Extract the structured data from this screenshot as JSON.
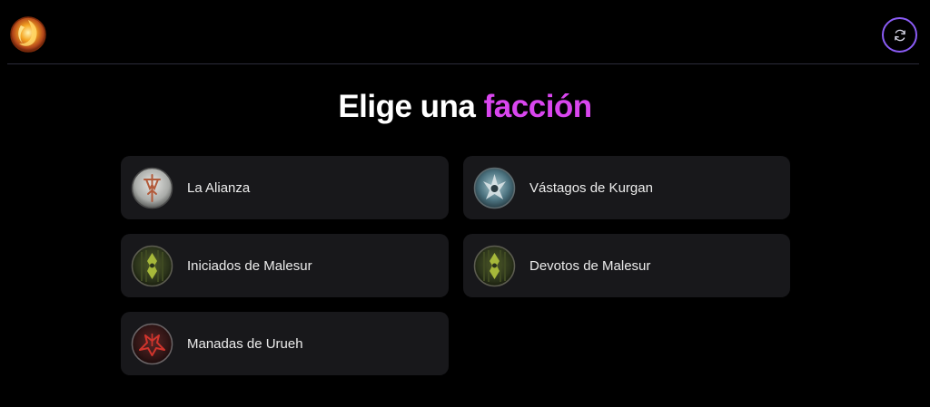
{
  "header": {
    "logo_icon": "phoenix-logo",
    "refresh_icon": "refresh-icon"
  },
  "heading": {
    "prefix": "Elige una",
    "accent": "facción",
    "accent_color": "#d946ef"
  },
  "factions": [
    {
      "label": "La Alianza",
      "icon": "alianza-emblem-icon"
    },
    {
      "label": "Vástagos de Kurgan",
      "icon": "kurgan-emblem-icon"
    },
    {
      "label": "Iniciados de Malesur",
      "icon": "malesur-emblem-icon"
    },
    {
      "label": "Devotos de Malesur",
      "icon": "malesur-emblem-icon"
    },
    {
      "label": "Manadas de Urueh",
      "icon": "urueh-emblem-icon"
    }
  ],
  "colors": {
    "background": "#000000",
    "card": "#18181b",
    "button_border": "#8b5cf6"
  }
}
